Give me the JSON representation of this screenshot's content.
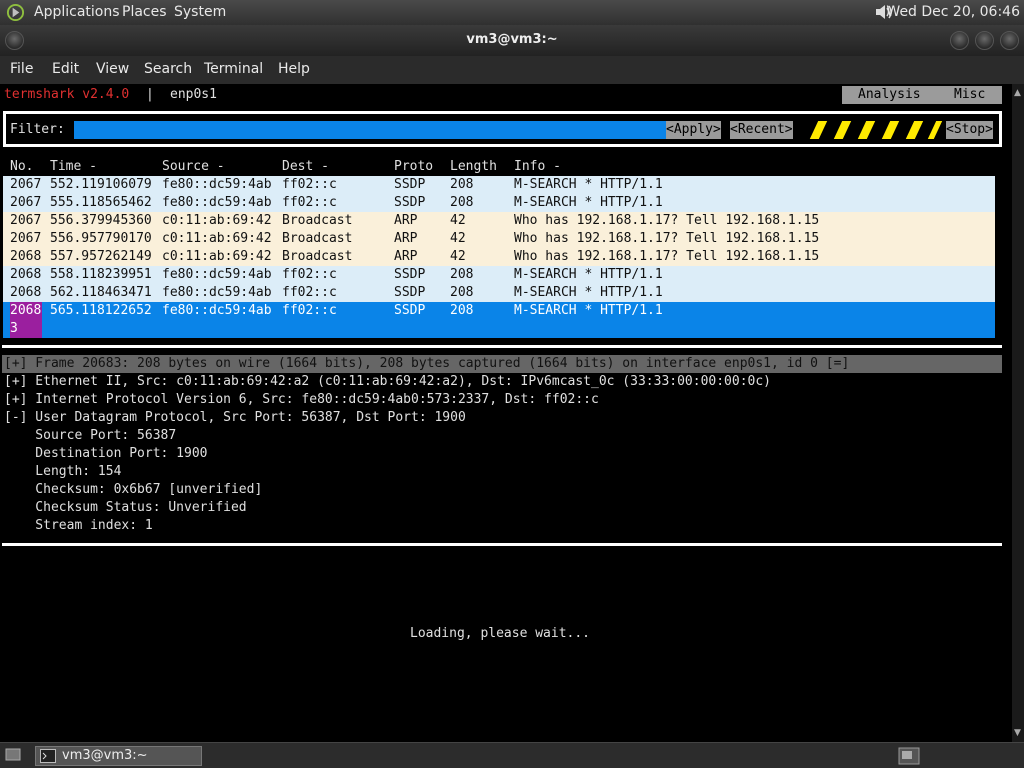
{
  "panel": {
    "applications": "Applications",
    "places": "Places",
    "system": "System",
    "clock": "Wed Dec 20, 06:46"
  },
  "window": {
    "title": "vm3@vm3:~"
  },
  "menubar": [
    "File",
    "Edit",
    "View",
    "Search",
    "Terminal",
    "Help"
  ],
  "termshark": {
    "app_name": "termshark v2.4.0",
    "separator": "|",
    "interface": "enp0s1",
    "tabs": {
      "analysis": "Analysis",
      "misc": "Misc"
    },
    "filter": {
      "label": "Filter:",
      "value": "",
      "apply": "<Apply>",
      "recent": "<Recent>",
      "stop": "<Stop>"
    },
    "columns": [
      "No.",
      "Time -",
      "Source -",
      "Dest -",
      "Proto",
      "Length",
      "Info -"
    ],
    "packets": [
      {
        "no": "2067",
        "time": "552.119106079",
        "src": "fe80::dc59:4ab",
        "dst": "ff02::c",
        "proto": "SSDP",
        "len": "208",
        "info": "M-SEARCH * HTTP/1.1"
      },
      {
        "no": "2067",
        "time": "555.118565462",
        "src": "fe80::dc59:4ab",
        "dst": "ff02::c",
        "proto": "SSDP",
        "len": "208",
        "info": "M-SEARCH * HTTP/1.1"
      },
      {
        "no": "2067",
        "time": "556.379945360",
        "src": "c0:11:ab:69:42",
        "dst": "Broadcast",
        "proto": "ARP",
        "len": "42",
        "info": "Who has 192.168.1.17? Tell 192.168.1.15"
      },
      {
        "no": "2067",
        "time": "556.957790170",
        "src": "c0:11:ab:69:42",
        "dst": "Broadcast",
        "proto": "ARP",
        "len": "42",
        "info": "Who has 192.168.1.17? Tell 192.168.1.15"
      },
      {
        "no": "2068",
        "time": "557.957262149",
        "src": "c0:11:ab:69:42",
        "dst": "Broadcast",
        "proto": "ARP",
        "len": "42",
        "info": "Who has 192.168.1.17? Tell 192.168.1.15"
      },
      {
        "no": "2068",
        "time": "558.118239951",
        "src": "fe80::dc59:4ab",
        "dst": "ff02::c",
        "proto": "SSDP",
        "len": "208",
        "info": "M-SEARCH * HTTP/1.1"
      },
      {
        "no": "2068",
        "time": "562.118463471",
        "src": "fe80::dc59:4ab",
        "dst": "ff02::c",
        "proto": "SSDP",
        "len": "208",
        "info": "M-SEARCH * HTTP/1.1"
      }
    ],
    "selected": {
      "no": "2068\n3",
      "time": "565.118122652",
      "src": "fe80::dc59:4ab",
      "dst": "ff02::c",
      "proto": "SSDP",
      "len": "208",
      "info": "M-SEARCH * HTTP/1.1"
    },
    "details": [
      "[+] Frame 20683: 208 bytes on wire (1664 bits), 208 bytes captured (1664 bits) on interface enp0s1, id 0 [=]",
      "[+] Ethernet II, Src: c0:11:ab:69:42:a2 (c0:11:ab:69:42:a2), Dst: IPv6mcast_0c (33:33:00:00:00:0c)",
      "[+] Internet Protocol Version 6, Src: fe80::dc59:4ab0:573:2337, Dst: ff02::c",
      "[-] User Datagram Protocol, Src Port: 56387, Dst Port: 1900",
      "    Source Port: 56387",
      "    Destination Port: 1900",
      "    Length: 154",
      "    Checksum: 0x6b67 [unverified]",
      "    Checksum Status: Unverified",
      "    Stream index: 1"
    ],
    "loading": "Loading, please wait..."
  },
  "taskbar": {
    "item": "vm3@vm3:~"
  }
}
